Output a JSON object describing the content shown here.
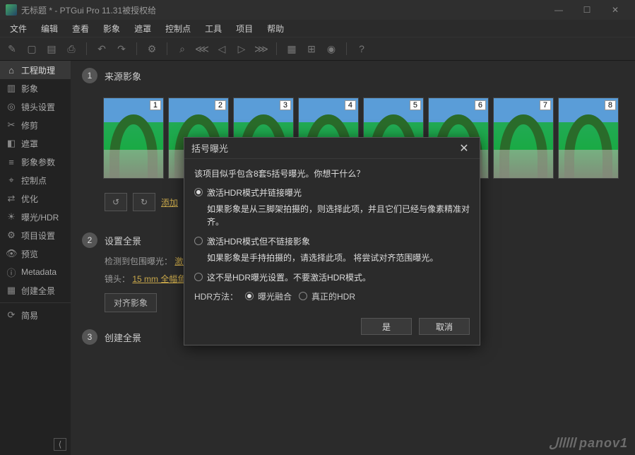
{
  "titlebar": {
    "title": "无标题 * - PTGui Pro 11.31被授权给"
  },
  "menubar": [
    "文件",
    "编辑",
    "查看",
    "影象",
    "遮罩",
    "控制点",
    "工具",
    "项目",
    "帮助"
  ],
  "sidebar": {
    "items": [
      {
        "icon": "⌂",
        "label": "工程助理",
        "active": true
      },
      {
        "icon": "▥",
        "label": "影象"
      },
      {
        "icon": "◎",
        "label": "镜头设置"
      },
      {
        "icon": "✂",
        "label": "修剪"
      },
      {
        "icon": "◧",
        "label": "遮罩"
      },
      {
        "icon": "≡",
        "label": "影象参数"
      },
      {
        "icon": "⌖",
        "label": "控制点"
      },
      {
        "icon": "⇄",
        "label": "优化"
      },
      {
        "icon": "☀",
        "label": "曝光/HDR"
      },
      {
        "icon": "⚙",
        "label": "项目设置"
      },
      {
        "icon": "👁",
        "label": "预览"
      },
      {
        "icon": "ⓘ",
        "label": "Metadata"
      },
      {
        "icon": "▦",
        "label": "创建全景"
      }
    ],
    "simple": {
      "icon": "⟳",
      "label": "简易"
    }
  },
  "steps": {
    "s1": {
      "num": "1",
      "title": "来源影象"
    },
    "s2": {
      "num": "2",
      "title": "设置全景"
    },
    "s3": {
      "num": "3",
      "title": "创建全景"
    }
  },
  "thumbs": [
    "1",
    "2",
    "3",
    "4",
    "5",
    "6",
    "7",
    "8"
  ],
  "links": {
    "add": "添加"
  },
  "section2": {
    "detect_label": "检测到包围曝光：",
    "detect_link": "激活",
    "lens_label": "镜头：",
    "lens_link": "15 mm 全幅鱼",
    "align_btn": "对齐影象"
  },
  "dialog": {
    "title": "括号曝光",
    "message": "该项目似乎包含8套5括号曝光。你想干什么？",
    "opt1": {
      "label": "激活HDR模式并链接曝光",
      "desc": "如果影象是从三脚架拍摄的，则选择此项，并且它们已经与像素精准对齐。"
    },
    "opt2": {
      "label": "激活HDR模式但不链接影象",
      "desc": "如果影象是手持拍摄的，请选择此项。 将尝试对齐范围曝光。"
    },
    "opt3": {
      "label": "这不是HDR曝光设置。不要激活HDR模式。"
    },
    "hdr_label": "HDR方法：",
    "hdr_a": "曝光融合",
    "hdr_b": "真正的HDR",
    "btn_yes": "是",
    "btn_cancel": "取消"
  },
  "watermark": {
    "logo": "ااااال",
    "name": "panov1"
  }
}
